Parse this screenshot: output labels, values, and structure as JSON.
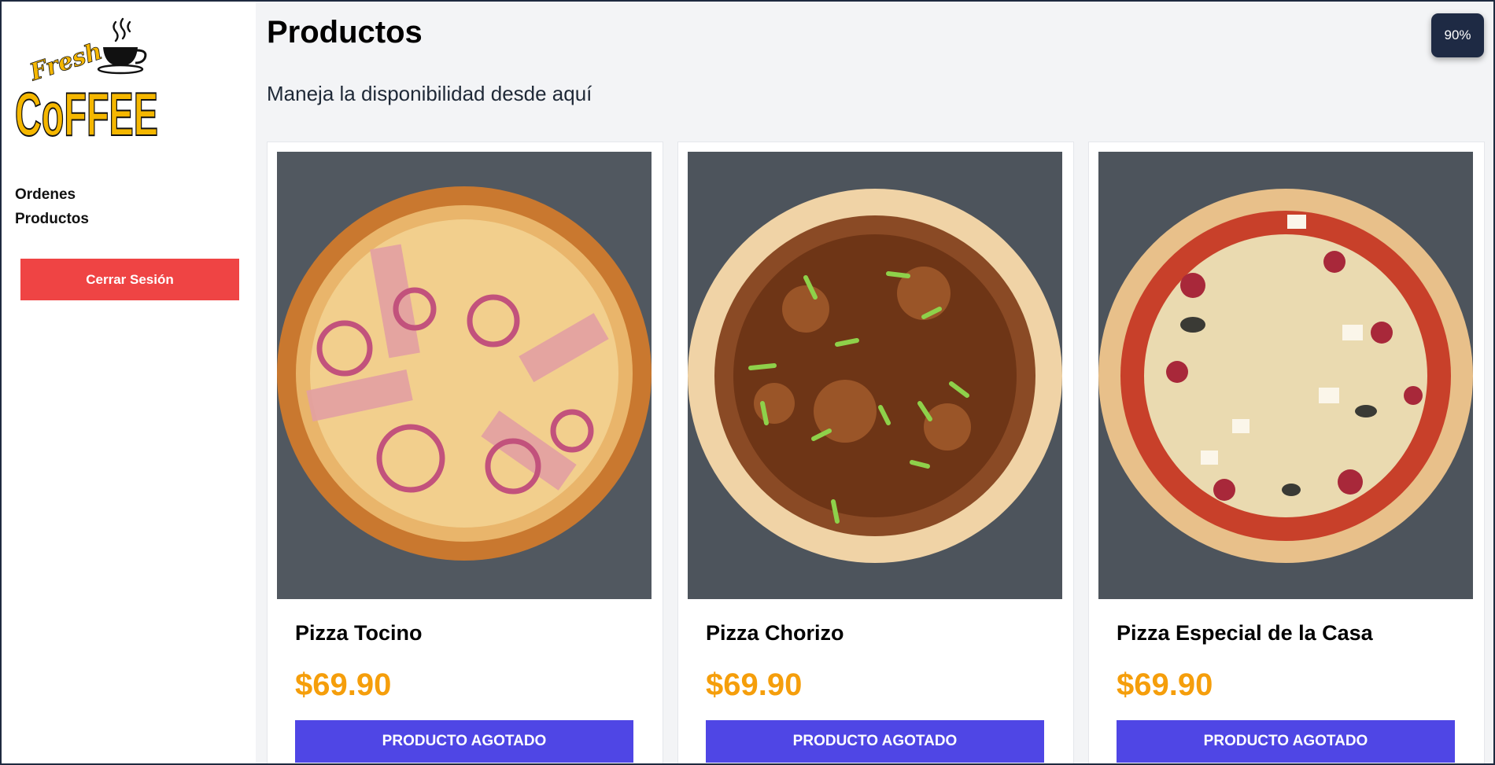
{
  "brand": {
    "logo_line1": "Fresh",
    "logo_line2": "CoFFEE",
    "logo_color": "#f5b700"
  },
  "sidebar": {
    "nav": [
      {
        "label": "Ordenes"
      },
      {
        "label": "Productos"
      }
    ],
    "logout_label": "Cerrar Sesión"
  },
  "main": {
    "title": "Productos",
    "subtitle": "Maneja la disponibilidad desde aquí"
  },
  "products": [
    {
      "name": "Pizza Tocino",
      "price": "$69.90",
      "button_label": "Producto Agotado",
      "image": "pizza-tocino"
    },
    {
      "name": "Pizza Chorizo",
      "price": "$69.90",
      "button_label": "Producto Agotado",
      "image": "pizza-chorizo"
    },
    {
      "name": "Pizza Especial de la Casa",
      "price": "$69.90",
      "button_label": "Producto Agotado",
      "image": "pizza-especial"
    }
  ],
  "zoom": {
    "level": "90%"
  },
  "colors": {
    "logout": "#ef4444",
    "price": "#f59e0b",
    "button": "#4f46e5",
    "badge": "#1e2a44"
  }
}
